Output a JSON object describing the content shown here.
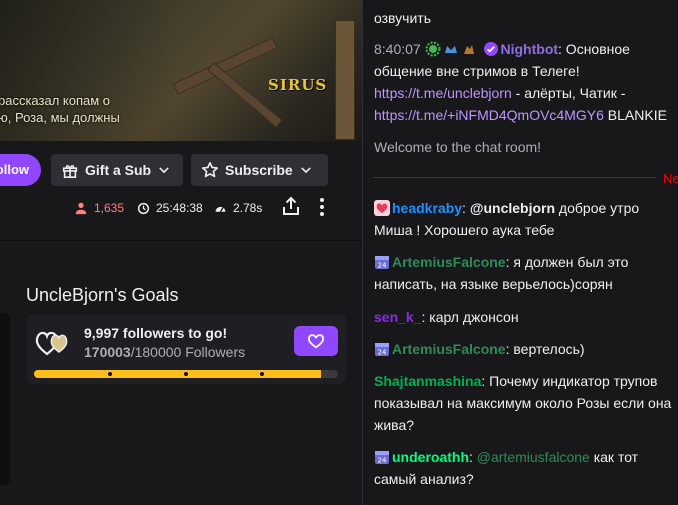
{
  "video": {
    "subtitle_line1": "рассказал копам о",
    "subtitle_line2": "ю, Роза, мы должны",
    "logo_text": "SIRUS"
  },
  "actions": {
    "follow_label": "ollow",
    "gift_label": "Gift a Sub",
    "subscribe_label": "Subscribe"
  },
  "stats": {
    "viewers": "1,635",
    "uptime": "25:48:38",
    "latency": "2.78s"
  },
  "goals": {
    "title": "UncleBjorn's Goals",
    "headline": "9,997 followers to go!",
    "current": "170003",
    "target": "/180000 Followers",
    "progress_fraction": 0.944
  },
  "chat": {
    "top_fragment": "озвучить",
    "nightbot": {
      "time": "8:40:07",
      "user": "Nightbot",
      "text1": ": Основное общение вне стримов в Телеге! ",
      "link1": "https://t.me/unclebjorn",
      "text2": " - алёрты, Чатик - ",
      "link2": "https://t.me/+iNFMD4QmOVc4MGY6",
      "text3": " BLANKIE"
    },
    "welcome": "Welcome to the chat room!",
    "new_label": "Ne",
    "messages": [
      {
        "user": "headkraby",
        "color": "#1e90ff",
        "mention": "@unclebjorn",
        "text": " доброе утро Миша ! Хорошего аука тебе"
      },
      {
        "user": "ArtemiusFalcone",
        "color": "#2e8b57",
        "text": ": я должен был это написать, на языке верьелось)сорян"
      },
      {
        "user": "sen_k_",
        "color": "#8a2be2",
        "text": ": карл джонсон"
      },
      {
        "user": "ArtemiusFalcone",
        "color": "#2e8b57",
        "text": ": вертелось)"
      },
      {
        "user": "Shajtanmashina",
        "color": "#00b050",
        "text": ": Почему индикатор трупов показывал на максимум около Розы если она жива?"
      },
      {
        "user": "underoathh",
        "color": "#00ff7f",
        "mention": "@artemiusfalcone",
        "text": " как тот самый анализ?"
      }
    ]
  }
}
